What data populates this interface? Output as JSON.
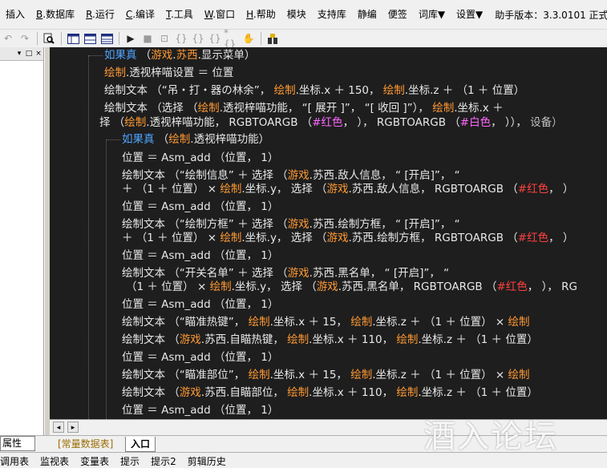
{
  "menu": {
    "items": [
      {
        "key": "",
        "label": "插入"
      },
      {
        "key": "B",
        "label": ".数据库"
      },
      {
        "key": "R",
        "label": ".运行"
      },
      {
        "key": "C",
        "label": ".编译"
      },
      {
        "key": "T",
        "label": ".工具"
      },
      {
        "key": "W",
        "label": ".窗口"
      },
      {
        "key": "H",
        "label": ".帮助"
      },
      {
        "key": "",
        "label": "模块"
      },
      {
        "key": "",
        "label": "支持库"
      },
      {
        "key": "",
        "label": "静编"
      },
      {
        "key": "",
        "label": "便签"
      },
      {
        "key": "",
        "label": "词库▼"
      },
      {
        "key": "",
        "label": "设置▼"
      }
    ],
    "version": "助手版本：3.3.0101 正式"
  },
  "toolbar": {
    "icons": [
      "undo-icon",
      "redo-icon",
      "find-icon",
      "layout1-icon",
      "layout2-icon",
      "layout3-icon",
      "run-icon",
      "stop-icon",
      "step1-icon",
      "step2-icon",
      "step3-icon",
      "step4-icon",
      "step5-icon",
      "hand-icon",
      "tool-icon"
    ]
  },
  "editor": {
    "lines": [
      [
        [
          "b",
          "如果真"
        ],
        [
          "k",
          " （"
        ],
        [
          "o",
          "游戏"
        ],
        [
          "k",
          "."
        ],
        [
          "o",
          "苏西"
        ],
        [
          "k",
          ".显示菜单）"
        ]
      ],
      [
        [
          "o",
          "绘制"
        ],
        [
          "k",
          ".透视梓喵设置 ＝ 位置"
        ]
      ],
      [
        [
          "k",
          "绘制文本 （“吊・打・器の林余”， "
        ],
        [
          "o",
          "绘制"
        ],
        [
          "k",
          ".坐标.x ＋ 150， "
        ],
        [
          "o",
          "绘制"
        ],
        [
          "k",
          ".坐标.z ＋ （1 ＋ 位置）"
        ]
      ],
      [
        [
          "k",
          "绘制文本 （选择 （"
        ],
        [
          "o",
          "绘制"
        ],
        [
          "k",
          ".透视梓喵功能， “[ 展开 ]”， “[ 收回 ]”）， "
        ],
        [
          "o",
          "绘制"
        ],
        [
          "k",
          ".坐标.x ＋"
        ]
      ],
      [
        [
          "k",
          "择 （"
        ],
        [
          "o",
          "绘制"
        ],
        [
          "k",
          ".透视梓喵功能， RGBTOARGB （"
        ],
        [
          "p",
          "#红色"
        ],
        [
          "k",
          "， ）， RGBTOARGB （"
        ],
        [
          "p",
          "#白色"
        ],
        [
          "k",
          "， ））， "
        ],
        [
          "g",
          "设备）"
        ]
      ],
      [
        [
          "b",
          "如果真"
        ],
        [
          "k",
          " （"
        ],
        [
          "o",
          "绘制"
        ],
        [
          "k",
          ".透视梓喵功能）"
        ]
      ],
      [
        [
          "k",
          "位置 ＝ Asm_add （位置， 1）"
        ]
      ],
      [
        [
          "k",
          "绘制文本 （“绘制信息” ＋ 选择 （"
        ],
        [
          "o",
          "游戏"
        ],
        [
          "k",
          ".苏西.敌人信息， “         [开启]”， “"
        ]
      ],
      [
        [
          "k",
          "＋ （1 ＋ 位置） × "
        ],
        [
          "o",
          "绘制"
        ],
        [
          "k",
          ".坐标.y， 选择 （"
        ],
        [
          "o",
          "游戏"
        ],
        [
          "k",
          ".苏西.敌人信息， RGBTOARGB （"
        ],
        [
          "r",
          "#红色"
        ],
        [
          "k",
          "， ）"
        ]
      ],
      [
        [
          "k",
          "位置 ＝ Asm_add （位置， 1）"
        ]
      ],
      [
        [
          "k",
          "绘制文本 （“绘制方框” ＋ 选择 （"
        ],
        [
          "o",
          "游戏"
        ],
        [
          "k",
          ".苏西.绘制方框， “         [开启]”， “"
        ]
      ],
      [
        [
          "k",
          "＋ （1 ＋ 位置） × "
        ],
        [
          "o",
          "绘制"
        ],
        [
          "k",
          ".坐标.y， 选择 （"
        ],
        [
          "o",
          "游戏"
        ],
        [
          "k",
          ".苏西.绘制方框， RGBTOARGB （"
        ],
        [
          "r",
          "#红色"
        ],
        [
          "k",
          "， ）"
        ]
      ],
      [
        [
          "k",
          "位置 ＝ Asm_add （位置， 1）"
        ]
      ],
      [
        [
          "k",
          "绘制文本 （“开关名单” ＋ 选择 （"
        ],
        [
          "o",
          "游戏"
        ],
        [
          "k",
          ".苏西.黑名单， “         [开启]”， “"
        ]
      ],
      [
        [
          "k",
          "（1 ＋ 位置） × "
        ],
        [
          "o",
          "绘制"
        ],
        [
          "k",
          ".坐标.y， 选择 （"
        ],
        [
          "o",
          "游戏"
        ],
        [
          "k",
          ".苏西.黑名单， RGBTOARGB （"
        ],
        [
          "r",
          "#红色"
        ],
        [
          "k",
          "， ）， RG"
        ]
      ],
      [
        [
          "k",
          "位置 ＝ Asm_add （位置， 1）"
        ]
      ],
      [
        [
          "k",
          "绘制文本 （“瞄准热键”， "
        ],
        [
          "o",
          "绘制"
        ],
        [
          "k",
          ".坐标.x ＋ 15， "
        ],
        [
          "o",
          "绘制"
        ],
        [
          "k",
          ".坐标.z ＋ （1 ＋ 位置） × "
        ],
        [
          "o",
          "绘制"
        ]
      ],
      [
        [
          "k",
          "绘制文本 （"
        ],
        [
          "o",
          "游戏"
        ],
        [
          "k",
          ".苏西.自瞄热键， "
        ],
        [
          "o",
          "绘制"
        ],
        [
          "k",
          ".坐标.x ＋ 110， "
        ],
        [
          "o",
          "绘制"
        ],
        [
          "k",
          ".坐标.z ＋ （1 ＋ 位置）"
        ]
      ],
      [
        [
          "k",
          "位置 ＝ Asm_add （位置， 1）"
        ]
      ],
      [
        [
          "k",
          "绘制文本 （“瞄准部位”， "
        ],
        [
          "o",
          "绘制"
        ],
        [
          "k",
          ".坐标.x ＋ 15， "
        ],
        [
          "o",
          "绘制"
        ],
        [
          "k",
          ".坐标.z ＋ （1 ＋ 位置） × "
        ],
        [
          "o",
          "绘制"
        ]
      ],
      [
        [
          "k",
          "绘制文本 （"
        ],
        [
          "o",
          "游戏"
        ],
        [
          "k",
          ".苏西.自瞄部位， "
        ],
        [
          "o",
          "绘制"
        ],
        [
          "k",
          ".坐标.x ＋ 110， "
        ],
        [
          "o",
          "绘制"
        ],
        [
          "k",
          ".坐标.z ＋ （1 ＋ 位置）"
        ]
      ],
      [
        [
          "k",
          "位置 ＝ Asm_add （位置， 1）"
        ]
      ]
    ]
  },
  "left_panel": {
    "pin": "▾",
    "restore": "□",
    "close": "×"
  },
  "tabs": {
    "attr": "属性",
    "t1": "[常量数据表]",
    "t2": "入口"
  },
  "watermark": "酒入论坛",
  "status": [
    "调用表",
    "监视表",
    "变量表",
    "提示",
    "提示2",
    "剪辑历史"
  ]
}
